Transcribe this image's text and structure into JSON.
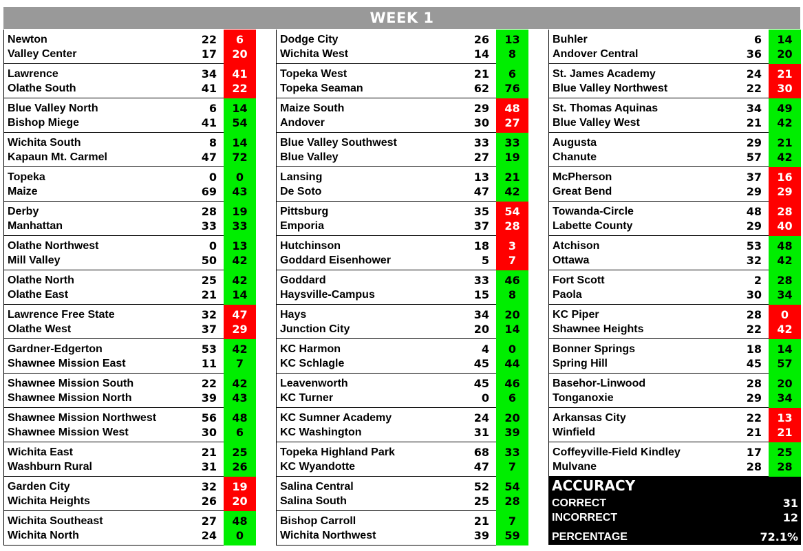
{
  "header": {
    "title": "WEEK 1"
  },
  "colors": {
    "correct": "#00ee00",
    "incorrect": "#ff0000",
    "header_bg": "#999999"
  },
  "columns": [
    {
      "games": [
        {
          "teams": [
            "Newton",
            "Valley Center"
          ],
          "actual": [
            "22",
            "17"
          ],
          "predicted": [
            "6",
            "20"
          ],
          "result": "incorrect"
        },
        {
          "teams": [
            "Lawrence",
            "Olathe South"
          ],
          "actual": [
            "34",
            "41"
          ],
          "predicted": [
            "41",
            "22"
          ],
          "result": "incorrect"
        },
        {
          "teams": [
            "Blue Valley North",
            "Bishop Miege"
          ],
          "actual": [
            "6",
            "41"
          ],
          "predicted": [
            "14",
            "54"
          ],
          "result": "correct"
        },
        {
          "teams": [
            "Wichita South",
            "Kapaun Mt. Carmel"
          ],
          "actual": [
            "8",
            "47"
          ],
          "predicted": [
            "14",
            "72"
          ],
          "result": "correct"
        },
        {
          "teams": [
            "Topeka",
            "Maize"
          ],
          "actual": [
            "0",
            "69"
          ],
          "predicted": [
            "0",
            "43"
          ],
          "result": "correct"
        },
        {
          "teams": [
            "Derby",
            "Manhattan"
          ],
          "actual": [
            "28",
            "33"
          ],
          "predicted": [
            "19",
            "33"
          ],
          "result": "correct"
        },
        {
          "teams": [
            "Olathe Northwest",
            "Mill Valley"
          ],
          "actual": [
            "0",
            "50"
          ],
          "predicted": [
            "13",
            "42"
          ],
          "result": "correct"
        },
        {
          "teams": [
            "Olathe North",
            "Olathe East"
          ],
          "actual": [
            "25",
            "21"
          ],
          "predicted": [
            "42",
            "14"
          ],
          "result": "correct"
        },
        {
          "teams": [
            "Lawrence Free State",
            "Olathe West"
          ],
          "actual": [
            "32",
            "37"
          ],
          "predicted": [
            "47",
            "29"
          ],
          "result": "incorrect"
        },
        {
          "teams": [
            "Gardner-Edgerton",
            "Shawnee Mission East"
          ],
          "actual": [
            "53",
            "11"
          ],
          "predicted": [
            "42",
            "7"
          ],
          "result": "correct"
        },
        {
          "teams": [
            "Shawnee Mission South",
            "Shawnee Mission North"
          ],
          "actual": [
            "22",
            "39"
          ],
          "predicted": [
            "42",
            "43"
          ],
          "result": "correct"
        },
        {
          "teams": [
            "Shawnee Mission Northwest",
            "Shawnee Mission West"
          ],
          "actual": [
            "56",
            "30"
          ],
          "predicted": [
            "48",
            "6"
          ],
          "result": "correct"
        },
        {
          "teams": [
            "Wichita East",
            "Washburn Rural"
          ],
          "actual": [
            "21",
            "31"
          ],
          "predicted": [
            "25",
            "26"
          ],
          "result": "correct"
        },
        {
          "teams": [
            "Garden City",
            "Wichita Heights"
          ],
          "actual": [
            "32",
            "26"
          ],
          "predicted": [
            "19",
            "20"
          ],
          "result": "incorrect"
        },
        {
          "teams": [
            "Wichita Southeast",
            "Wichita North"
          ],
          "actual": [
            "27",
            "24"
          ],
          "predicted": [
            "48",
            "0"
          ],
          "result": "correct"
        }
      ]
    },
    {
      "games": [
        {
          "teams": [
            "Dodge City",
            "Wichita West"
          ],
          "actual": [
            "26",
            "14"
          ],
          "predicted": [
            "13",
            "8"
          ],
          "result": "correct"
        },
        {
          "teams": [
            "Topeka West",
            "Topeka Seaman"
          ],
          "actual": [
            "21",
            "62"
          ],
          "predicted": [
            "6",
            "76"
          ],
          "result": "correct"
        },
        {
          "teams": [
            "Maize South",
            "Andover"
          ],
          "actual": [
            "29",
            "30"
          ],
          "predicted": [
            "48",
            "27"
          ],
          "result": "incorrect"
        },
        {
          "teams": [
            "Blue Valley Southwest",
            "Blue Valley"
          ],
          "actual": [
            "33",
            "27"
          ],
          "predicted": [
            "33",
            "19"
          ],
          "result": "correct"
        },
        {
          "teams": [
            "Lansing",
            "De Soto"
          ],
          "actual": [
            "13",
            "47"
          ],
          "predicted": [
            "21",
            "42"
          ],
          "result": "correct"
        },
        {
          "teams": [
            "Pittsburg",
            "Emporia"
          ],
          "actual": [
            "35",
            "37"
          ],
          "predicted": [
            "54",
            "28"
          ],
          "result": "incorrect"
        },
        {
          "teams": [
            "Hutchinson",
            "Goddard Eisenhower"
          ],
          "actual": [
            "18",
            "5"
          ],
          "predicted": [
            "3",
            "7"
          ],
          "result": "incorrect"
        },
        {
          "teams": [
            "Goddard",
            "Haysville-Campus"
          ],
          "actual": [
            "33",
            "15"
          ],
          "predicted": [
            "46",
            "8"
          ],
          "result": "correct"
        },
        {
          "teams": [
            "Hays",
            "Junction City"
          ],
          "actual": [
            "34",
            "20"
          ],
          "predicted": [
            "20",
            "14"
          ],
          "result": "correct"
        },
        {
          "teams": [
            "KC Harmon",
            "KC Schlagle"
          ],
          "actual": [
            "4",
            "45"
          ],
          "predicted": [
            "0",
            "44"
          ],
          "result": "correct"
        },
        {
          "teams": [
            "Leavenworth",
            "KC Turner"
          ],
          "actual": [
            "45",
            "0"
          ],
          "predicted": [
            "46",
            "6"
          ],
          "result": "correct"
        },
        {
          "teams": [
            "KC Sumner Academy",
            "KC Washington"
          ],
          "actual": [
            "24",
            "31"
          ],
          "predicted": [
            "20",
            "39"
          ],
          "result": "correct"
        },
        {
          "teams": [
            "Topeka Highland Park",
            "KC Wyandotte"
          ],
          "actual": [
            "68",
            "47"
          ],
          "predicted": [
            "33",
            "7"
          ],
          "result": "correct"
        },
        {
          "teams": [
            "Salina Central",
            "Salina South"
          ],
          "actual": [
            "52",
            "25"
          ],
          "predicted": [
            "54",
            "28"
          ],
          "result": "correct"
        },
        {
          "teams": [
            "Bishop Carroll",
            "Wichita Northwest"
          ],
          "actual": [
            "21",
            "39"
          ],
          "predicted": [
            "7",
            "59"
          ],
          "result": "correct"
        }
      ]
    },
    {
      "games": [
        {
          "teams": [
            "Buhler",
            "Andover Central"
          ],
          "actual": [
            "6",
            "36"
          ],
          "predicted": [
            "14",
            "20"
          ],
          "result": "correct"
        },
        {
          "teams": [
            "St. James Academy",
            "Blue Valley Northwest"
          ],
          "actual": [
            "24",
            "22"
          ],
          "predicted": [
            "21",
            "30"
          ],
          "result": "incorrect"
        },
        {
          "teams": [
            "St. Thomas Aquinas",
            "Blue Valley West"
          ],
          "actual": [
            "34",
            "21"
          ],
          "predicted": [
            "49",
            "42"
          ],
          "result": "correct"
        },
        {
          "teams": [
            "Augusta",
            "Chanute"
          ],
          "actual": [
            "29",
            "57"
          ],
          "predicted": [
            "21",
            "42"
          ],
          "result": "correct"
        },
        {
          "teams": [
            "McPherson",
            "Great Bend"
          ],
          "actual": [
            "37",
            "29"
          ],
          "predicted": [
            "16",
            "29"
          ],
          "result": "incorrect"
        },
        {
          "teams": [
            "Towanda-Circle",
            "Labette County"
          ],
          "actual": [
            "48",
            "29"
          ],
          "predicted": [
            "28",
            "40"
          ],
          "result": "incorrect"
        },
        {
          "teams": [
            "Atchison",
            "Ottawa"
          ],
          "actual": [
            "53",
            "32"
          ],
          "predicted": [
            "48",
            "42"
          ],
          "result": "correct"
        },
        {
          "teams": [
            "Fort Scott",
            "Paola"
          ],
          "actual": [
            "2",
            "30"
          ],
          "predicted": [
            "28",
            "34"
          ],
          "result": "correct"
        },
        {
          "teams": [
            "KC Piper",
            "Shawnee Heights"
          ],
          "actual": [
            "28",
            "22"
          ],
          "predicted": [
            "0",
            "42"
          ],
          "result": "incorrect"
        },
        {
          "teams": [
            "Bonner Springs",
            "Spring Hill"
          ],
          "actual": [
            "18",
            "45"
          ],
          "predicted": [
            "14",
            "57"
          ],
          "result": "correct"
        },
        {
          "teams": [
            "Basehor-Linwood",
            "Tonganoxie"
          ],
          "actual": [
            "28",
            "29"
          ],
          "predicted": [
            "20",
            "34"
          ],
          "result": "correct"
        },
        {
          "teams": [
            "Arkansas City",
            "Winfield"
          ],
          "actual": [
            "22",
            "21"
          ],
          "predicted": [
            "13",
            "21"
          ],
          "result": "incorrect"
        },
        {
          "teams": [
            "Coffeyville-Field Kindley",
            "Mulvane"
          ],
          "actual": [
            "17",
            "28"
          ],
          "predicted": [
            "25",
            "28"
          ],
          "result": "correct"
        }
      ]
    }
  ],
  "accuracy": {
    "title": "ACCURACY",
    "correct_label": "CORRECT",
    "correct_value": "31",
    "incorrect_label": "INCORRECT",
    "incorrect_value": "12",
    "percentage_label": "PERCENTAGE",
    "percentage_value": "72.1%"
  }
}
